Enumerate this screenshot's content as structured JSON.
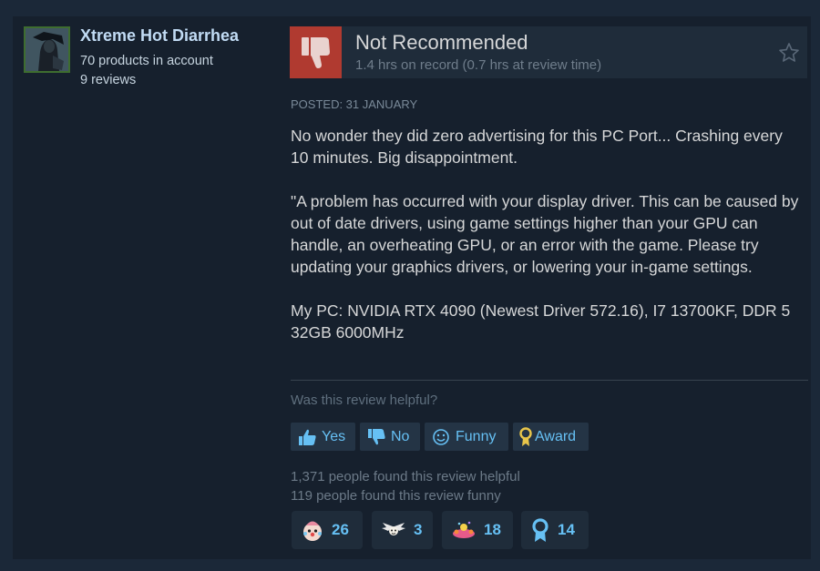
{
  "author": {
    "name": "Xtreme Hot Diarrhea",
    "products": "70 products in account",
    "reviews": "9 reviews"
  },
  "review": {
    "verdict": "Not Recommended",
    "hours": "1.4 hrs on record (0.7 hrs at review time)",
    "posted": "POSTED: 31 JANUARY",
    "paragraphs": [
      "No wonder they did zero advertising for this PC Port... Crashing every 10 minutes. Big disappointment.",
      "\"A problem has occurred with your display driver. This can be caused by out of date drivers, using game settings higher than your GPU can handle, an overheating GPU, or an error with the game. Please try updating your graphics drivers, or lowering your in-game settings.",
      "My PC: NVIDIA RTX 4090 (Newest Driver 572.16), I7 13700KF, DDR 5 32GB 6000MHz"
    ]
  },
  "feedback": {
    "question": "Was this review helpful?",
    "yes_label": "Yes",
    "no_label": "No",
    "funny_label": "Funny",
    "award_label": "Award",
    "helpful_count": "1,371 people found this review helpful",
    "funny_count": "119 people found this review funny"
  },
  "awards": [
    {
      "icon": "clown-award-icon",
      "count": "26"
    },
    {
      "icon": "winged-award-icon",
      "count": "3"
    },
    {
      "icon": "party-award-icon",
      "count": "18"
    },
    {
      "icon": "medal-award-icon",
      "count": "14"
    }
  ],
  "colors": {
    "background": "#1b2838",
    "panel": "#16202d",
    "thumb_down": "#b03a30",
    "link_blue": "#66c0f4",
    "author_name": "#c1dbf4"
  }
}
